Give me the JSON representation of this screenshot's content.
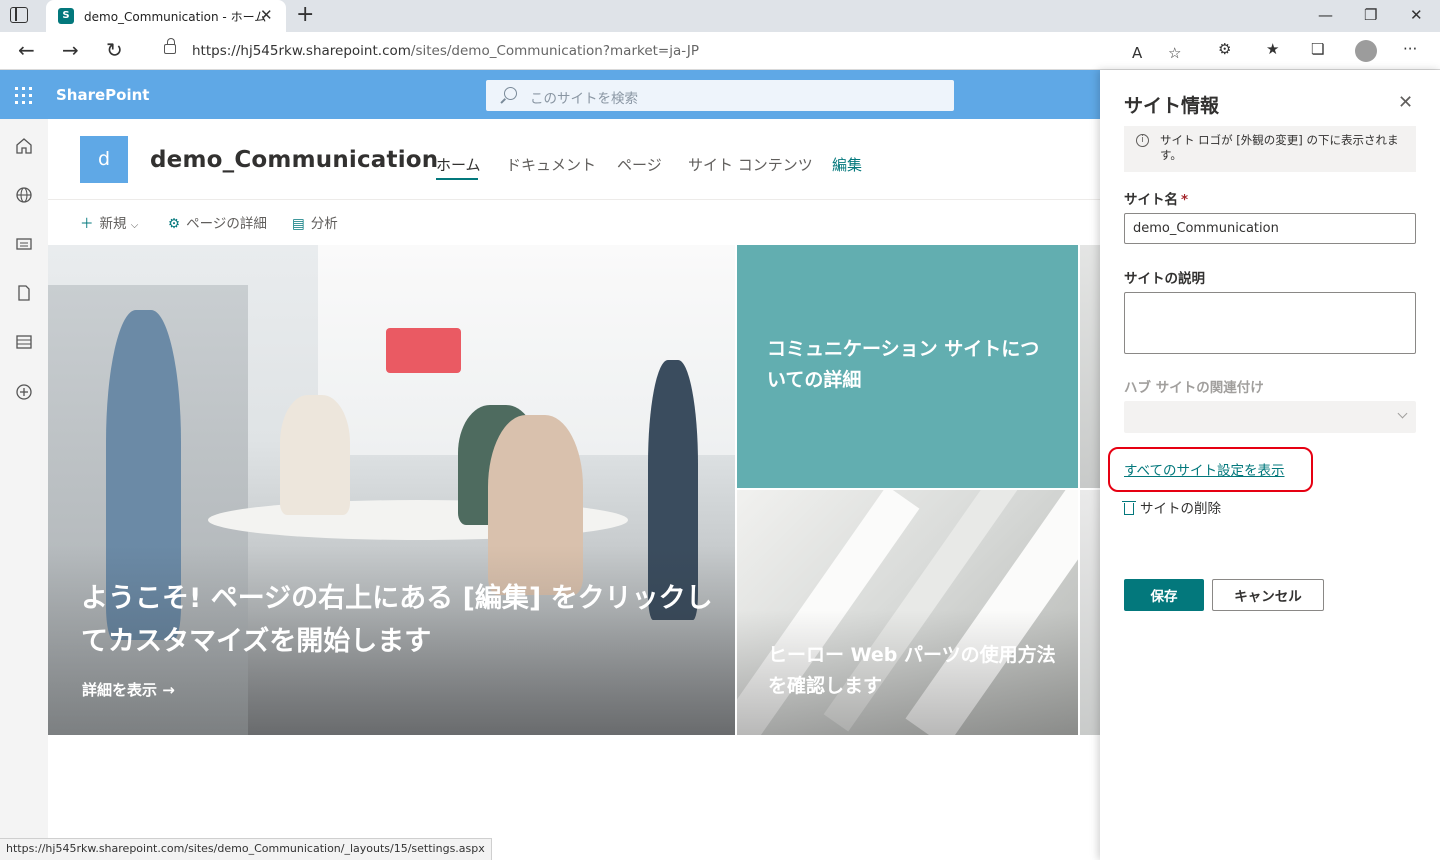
{
  "browser": {
    "tab_title": "demo_Communication - ホーム",
    "url_host": "https://hj545rkw.sharepoint.com",
    "url_path": "/sites/demo_Communication?market=ja-JP",
    "status_url": "https://hj545rkw.sharepoint.com/sites/demo_Communication/_layouts/15/settings.aspx"
  },
  "suitebar": {
    "brand": "SharePoint",
    "search_placeholder": "このサイトを検索",
    "color": "#5fa8e6"
  },
  "site": {
    "logo_letter": "d",
    "title": "demo_Communication",
    "nav": [
      {
        "label": "ホーム",
        "active": true
      },
      {
        "label": "ドキュメント"
      },
      {
        "label": "ページ"
      },
      {
        "label": "サイト コンテンツ"
      },
      {
        "label": "編集"
      }
    ]
  },
  "commandbar": {
    "new_label": "新規",
    "page_details_label": "ページの詳細",
    "analytics_label": "分析"
  },
  "hero": {
    "main_heading": "ようこそ! ページの右上にある [編集] をクリックしてカスタマイズを開始します",
    "main_link": "詳細を表示",
    "tile1_text": "コミュニケーション サイトについての詳細",
    "tile2_text": "ヒーロー Web パーツの使用方法を確認します",
    "tile1_color": "#62aeb0"
  },
  "panel": {
    "title": "サイト情報",
    "info_text": "サイト ロゴが [外観の変更] の下に表示されます。",
    "site_name_label": "サイト名",
    "required_mark": "*",
    "site_name_value": "demo_Communication",
    "description_label": "サイトの説明",
    "hub_label": "ハブ サイトの関連付け",
    "all_settings_link": "すべてのサイト設定を表示",
    "delete_label": "サイトの削除",
    "save_label": "保存",
    "cancel_label": "キャンセル",
    "accent": "#03787c",
    "highlight_color": "#e60012"
  }
}
